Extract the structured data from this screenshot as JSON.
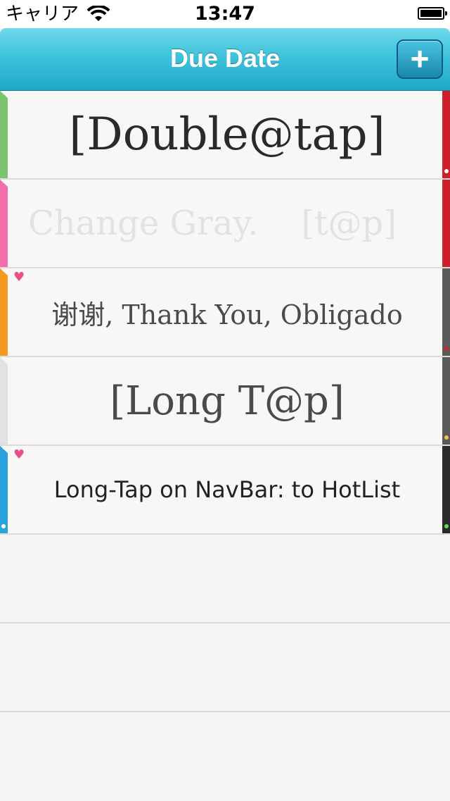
{
  "status_bar": {
    "carrier": "キャリア",
    "time": "13:47",
    "wifi_icon": "wifi-icon",
    "battery_icon": "battery-icon"
  },
  "nav_bar": {
    "title": "Due Date",
    "add_button_label": "+"
  },
  "rows": [
    {
      "text": "[Double@tap]",
      "left_color": "#7cc46d",
      "right_color": "#cc1f2a",
      "dot_color": "#ffffff",
      "text_color": "#2a2a2a",
      "heart": false
    },
    {
      "text": "Change Gray.    [t@p]",
      "left_color": "#f06fac",
      "right_color": "#cc1f2a",
      "dot_color": null,
      "text_color": "#e2e2e2",
      "heart": false
    },
    {
      "text": "谢谢, Thank You, Obligado",
      "left_color": "#f59a20",
      "right_color": "#5a5a5a",
      "dot_color": "#d91f26",
      "text_color": "#4a4a4a",
      "heart": true
    },
    {
      "text": "[Long T@p]",
      "left_color": "#e2e2e2",
      "right_color": "#5a5a5a",
      "dot_color": "#f2c060",
      "text_color": "#4a4a4a",
      "heart": false
    },
    {
      "text": "Long-Tap on NavBar: to HotList",
      "left_color": "#2aa2de",
      "right_color": "#2a2a2a",
      "dot_color": "#66dd55",
      "text_color": "#222222",
      "heart": true
    }
  ],
  "heart_icon": "♥"
}
